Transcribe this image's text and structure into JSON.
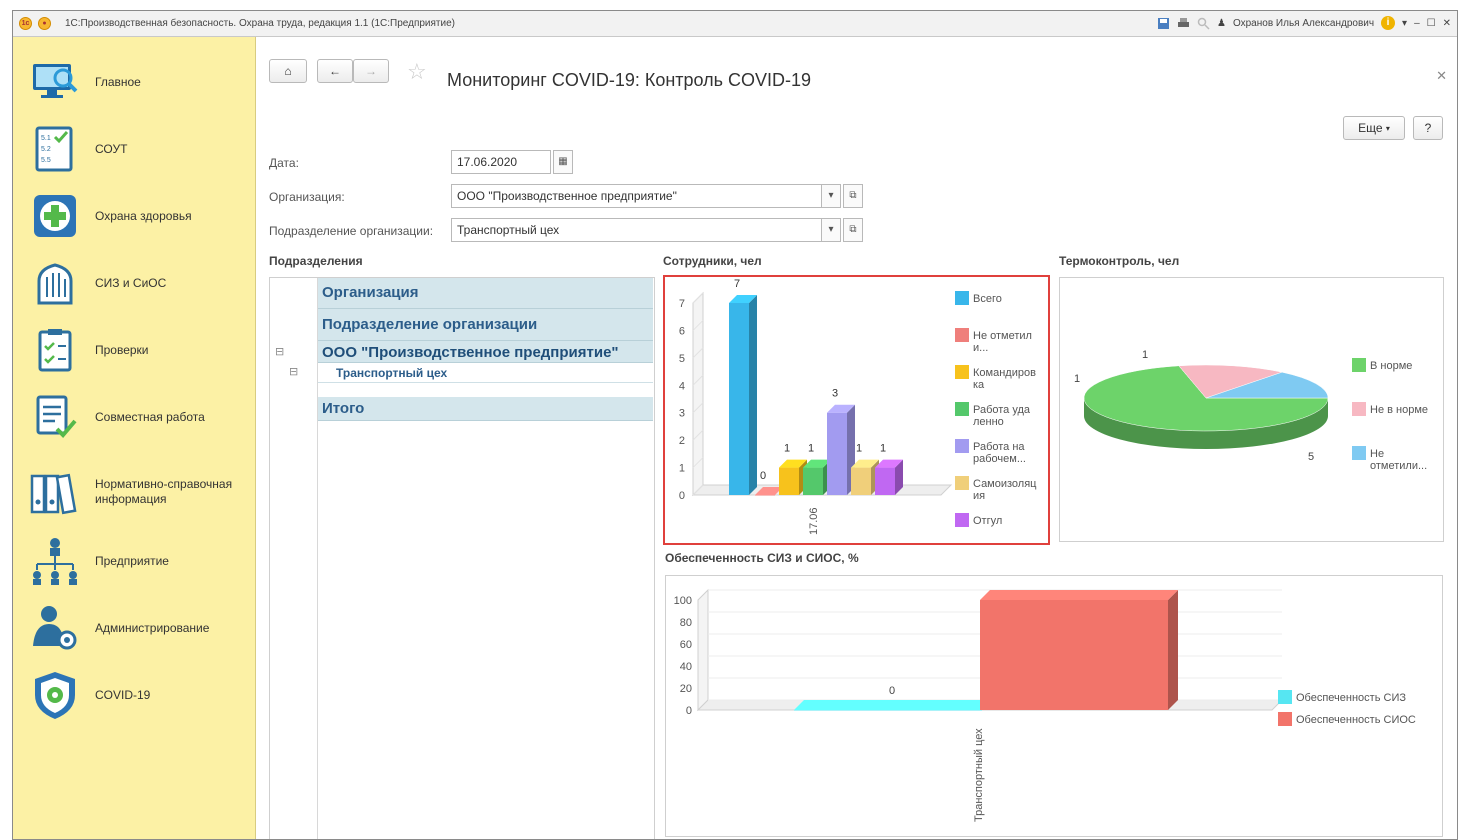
{
  "window": {
    "title": "1С:Производственная безопасность. Охрана труда, редакция 1.1  (1С:Предприятие)",
    "user": "Охранов Илья Александрович"
  },
  "sidebar": {
    "items": [
      {
        "label": "Главное",
        "icon": "monitor-search-icon"
      },
      {
        "label": "СОУТ",
        "icon": "checklist-icon"
      },
      {
        "label": "Охрана здоровья",
        "icon": "medical-cross-icon"
      },
      {
        "label": "СИЗ и СиОС",
        "icon": "glove-icon"
      },
      {
        "label": "Проверки",
        "icon": "clipboard-check-icon"
      },
      {
        "label": "Совместная работа",
        "icon": "document-check-icon"
      },
      {
        "label": "Нормативно-справочная информация",
        "icon": "binders-icon"
      },
      {
        "label": "Предприятие",
        "icon": "org-structure-icon"
      },
      {
        "label": "Администрирование",
        "icon": "admin-gear-icon"
      },
      {
        "label": "COVID-19",
        "icon": "shield-virus-icon"
      }
    ]
  },
  "header": {
    "title": "Мониторинг COVID-19: Контроль COVID-19",
    "more_label": "Еще",
    "help_label": "?"
  },
  "form": {
    "date_label": "Дата:",
    "date_value": "17.06.2020",
    "org_label": "Организация:",
    "org_value": "ООО \"Производственное предприятие\"",
    "dept_label": "Подразделение организации:",
    "dept_value": "Транспортный цех"
  },
  "tree": {
    "section_label": "Подразделения",
    "col_org": "Организация",
    "col_dept": "Подразделение организации",
    "org_row": "ООО \"Производственное предприятие\"",
    "dept_row": "Транспортный цех",
    "total_row": "Итого"
  },
  "colors": {
    "sidebar_bg": "#fcf1a5",
    "highlight_border": "#e0403c",
    "tree_band": "#d4e6ec"
  },
  "chart_data": [
    {
      "type": "bar",
      "title": "Сотрудники, чел",
      "categories": [
        "17.06"
      ],
      "ylim": [
        0,
        7
      ],
      "series": [
        {
          "name": "Всего",
          "values": [
            7
          ],
          "color": "#38b6ea"
        },
        {
          "name": "Не отметили...",
          "values": [
            0
          ],
          "color": "#ef7f7b"
        },
        {
          "name": "Командировка",
          "values": [
            1
          ],
          "color": "#f7c21c"
        },
        {
          "name": "Работа удаленно",
          "values": [
            1
          ],
          "color": "#54c86b"
        },
        {
          "name": "Работа на рабочем...",
          "values": [
            3
          ],
          "color": "#a29bf0"
        },
        {
          "name": "Самоизоляция",
          "values": [
            1
          ],
          "color": "#f0cf7a"
        },
        {
          "name": "Отгул",
          "values": [
            1
          ],
          "color": "#c068f2"
        }
      ],
      "legend": "right"
    },
    {
      "type": "pie",
      "title": "Термоконтроль, чел",
      "slices": [
        {
          "name": "В норме",
          "value": 5,
          "color": "#6dd36a"
        },
        {
          "name": "Не в норме",
          "value": 1,
          "color": "#f7b8c2"
        },
        {
          "name": "Не отметили...",
          "value": 1,
          "color": "#7fcaf2"
        }
      ],
      "legend": "right"
    },
    {
      "type": "bar",
      "title": "Обеспеченность СИЗ и СИОС, %",
      "categories": [
        "Транспортный цех"
      ],
      "ylim": [
        0,
        100
      ],
      "yticks": [
        0,
        20,
        40,
        60,
        80,
        100
      ],
      "series": [
        {
          "name": "Обеспеченность СИЗ",
          "values": [
            0
          ],
          "color": "#56e6f2"
        },
        {
          "name": "Обеспеченность СИОС",
          "values": [
            100
          ],
          "color": "#f2746a"
        }
      ],
      "legend": "right"
    }
  ]
}
